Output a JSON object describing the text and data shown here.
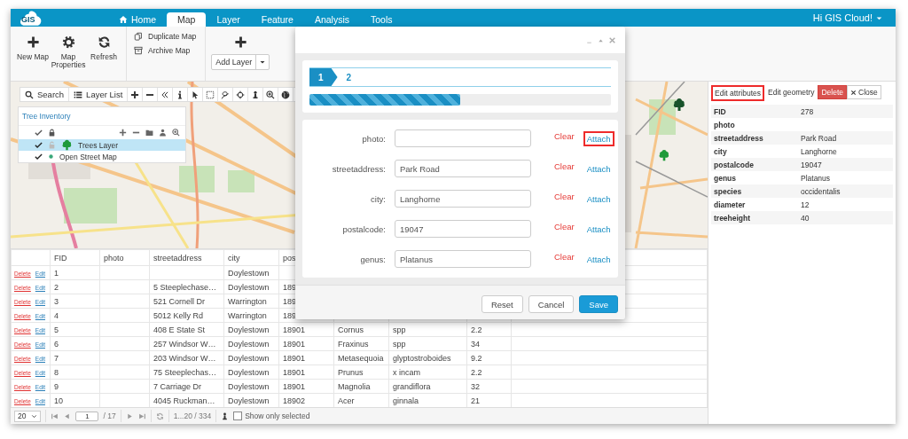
{
  "app": {
    "logo": "GIS",
    "greeting": "Hi GIS Cloud!"
  },
  "tabs": [
    {
      "label": "Home",
      "selected": false
    },
    {
      "label": "Map",
      "selected": true
    },
    {
      "label": "Layer",
      "selected": false
    },
    {
      "label": "Feature",
      "selected": false
    },
    {
      "label": "Analysis",
      "selected": false
    },
    {
      "label": "Tools",
      "selected": false
    }
  ],
  "ribbon": {
    "groups": [
      {
        "kind": "large",
        "buttons": [
          {
            "label": "New Map"
          },
          {
            "label": "Map Properties"
          },
          {
            "label": "Refresh"
          }
        ]
      },
      {
        "kind": "small",
        "buttons": [
          {
            "label": "Duplicate Map"
          },
          {
            "label": "Archive Map"
          }
        ]
      },
      {
        "kind": "dropdown",
        "buttons": [
          {
            "label": "Add Layer"
          }
        ]
      }
    ]
  },
  "map_toolbar": {
    "search": "Search",
    "layer_list": "Layer List"
  },
  "layer_panel": {
    "title": "Tree Inventory",
    "layers": [
      {
        "name": "Trees Layer",
        "kind": "vector",
        "checked": true,
        "selected": true
      },
      {
        "name": "Open Street Map",
        "kind": "basemap",
        "checked": true,
        "selected": false
      }
    ]
  },
  "table": {
    "columns": [
      "FID",
      "photo",
      "streetaddress",
      "city",
      "pos"
    ],
    "rows": [
      {
        "delete": "Delete",
        "edit": "Edit",
        "cells": [
          "1",
          null,
          null,
          "Doylestown"
        ]
      },
      {
        "delete": "Delete",
        "edit": "Edit",
        "cells": [
          "2",
          null,
          "5 Steeplechase…",
          "Doylestown",
          "189"
        ]
      },
      {
        "delete": "Delete",
        "edit": "Edit",
        "cells": [
          "3",
          null,
          "521 Cornell Dr",
          "Warrington",
          "189"
        ]
      },
      {
        "delete": "Delete",
        "edit": "Edit",
        "cells": [
          "4",
          null,
          "5012 Kelly Rd",
          "Warrington",
          "189"
        ]
      },
      {
        "delete": "Delete",
        "edit": "Edit",
        "cells": [
          "5",
          null,
          "408 E State St",
          "Doylestown",
          "18901",
          "Cornus",
          "spp",
          "2.2"
        ]
      },
      {
        "delete": "Delete",
        "edit": "Edit",
        "cells": [
          "6",
          null,
          "257 Windsor W…",
          "Doylestown",
          "18901",
          "Fraxinus",
          "spp",
          "34"
        ]
      },
      {
        "delete": "Delete",
        "edit": "Edit",
        "cells": [
          "7",
          null,
          "203 Windsor W…",
          "Doylestown",
          "18901",
          "Metasequoia",
          "glyptostroboides",
          "9.2"
        ]
      },
      {
        "delete": "Delete",
        "edit": "Edit",
        "cells": [
          "8",
          null,
          "75 Steeplechas…",
          "Doylestown",
          "18901",
          "Prunus",
          "x incam",
          "2.2"
        ]
      },
      {
        "delete": "Delete",
        "edit": "Edit",
        "cells": [
          "9",
          null,
          "7 Carriage Dr",
          "Doylestown",
          "18901",
          "Magnolia",
          "grandiflora",
          "32"
        ]
      },
      {
        "delete": "Delete",
        "edit": "Edit",
        "cells": [
          "10",
          null,
          "4045 Ruckman…",
          "Doylestown",
          "18902",
          "Acer",
          "ginnala",
          "21"
        ]
      }
    ]
  },
  "pager": {
    "page_size": "20",
    "page": "1",
    "pages": "/ 17",
    "range": "1...20 / 334",
    "show_only_selected": {
      "label": "Show only selected",
      "checked": false
    }
  },
  "feature_panel": {
    "buttons": [
      {
        "label": "Edit attributes",
        "kind": "default",
        "highlighted": true
      },
      {
        "label": "Edit geometry",
        "kind": "plain",
        "highlighted": false
      },
      {
        "label": "Delete",
        "kind": "danger",
        "highlighted": false
      },
      {
        "label": "Close",
        "kind": "close",
        "highlighted": false
      }
    ],
    "attributes": [
      {
        "name": "FID",
        "value": "278"
      },
      {
        "name": "photo"
      },
      {
        "name": "streetaddress",
        "value": "Park Road"
      },
      {
        "name": "city",
        "value": "Langhorne"
      },
      {
        "name": "postalcode",
        "value": "19047"
      },
      {
        "name": "genus",
        "value": "Platanus"
      },
      {
        "name": "species",
        "value": "occidentalis"
      },
      {
        "name": "diameter",
        "value": "12"
      },
      {
        "name": "treeheight",
        "value": "40"
      }
    ]
  },
  "dialog": {
    "steps": [
      {
        "label": "1",
        "selected": true
      },
      {
        "label": "2",
        "selected": false
      }
    ],
    "progress": {
      "level": 0.5
    },
    "fields": [
      {
        "label": "photo:",
        "clear": "Clear",
        "attach": {
          "label": "Attach",
          "highlighted": true
        }
      },
      {
        "label": "streetaddress:",
        "value": "Park Road",
        "clear": "Clear",
        "attach": {
          "label": "Attach",
          "highlighted": false
        }
      },
      {
        "label": "city:",
        "value": "Langhorne",
        "clear": "Clear",
        "attach": {
          "label": "Attach",
          "highlighted": false
        }
      },
      {
        "label": "postalcode:",
        "value": "19047",
        "clear": "Clear",
        "attach": {
          "label": "Attach",
          "highlighted": false
        }
      },
      {
        "label": "genus:",
        "value": "Platanus",
        "clear": "Clear",
        "attach": {
          "label": "Attach",
          "highlighted": false
        }
      }
    ],
    "buttons": [
      {
        "label": "Reset",
        "kind": "default"
      },
      {
        "label": "Cancel",
        "kind": "default"
      },
      {
        "label": "Save",
        "kind": "primary"
      }
    ]
  }
}
